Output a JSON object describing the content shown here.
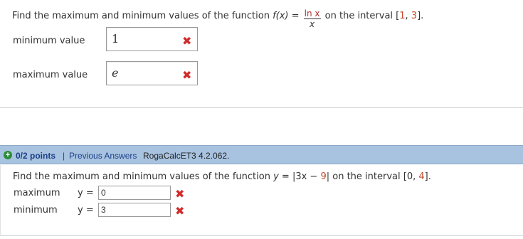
{
  "problem1": {
    "question_prefix": "Find the maximum and minimum values of the function ",
    "function_name": "f(x)",
    "equals": " = ",
    "frac_num": "ln x",
    "frac_den": "x",
    "interval_prefix": " on the interval ",
    "interval_open": "[",
    "interval_a": "1",
    "interval_comma": ", ",
    "interval_b": "3",
    "interval_close": "].",
    "rows": [
      {
        "label": "minimum value",
        "value": "1",
        "mark": "✖"
      },
      {
        "label": "maximum value",
        "value": "e",
        "mark": "✖"
      }
    ]
  },
  "problem2": {
    "header": {
      "icon": "plus-circle-icon",
      "points": "0/2 points",
      "separator": "|",
      "previous_answers": "Previous Answers",
      "source": "RogaCalcET3 4.2.062."
    },
    "question_prefix": "Find the maximum and minimum values of the function ",
    "function_text": "y",
    "function_body": " = |3x − ",
    "function_nine": "9",
    "function_end": "| ",
    "interval_prefix": " on the interval ",
    "interval_open": "[0, ",
    "interval_b": "4",
    "interval_close": "].",
    "rows": [
      {
        "label": "maximum",
        "y_eq": "y = ",
        "value": "0",
        "mark": "✖"
      },
      {
        "label": "minimum",
        "y_eq": "y = ",
        "value": "3",
        "mark": "✖"
      }
    ]
  },
  "colors": {
    "header_bg": "#a8c3e0",
    "link": "#1d3f8a",
    "wrong_mark": "#d22b2b",
    "highlight": "#c24a2b"
  }
}
